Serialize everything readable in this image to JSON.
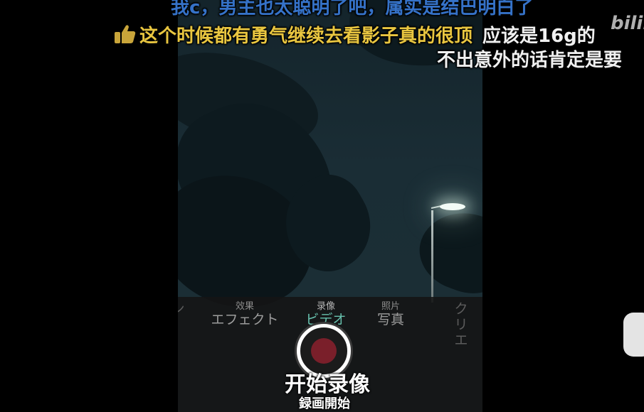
{
  "video": {
    "camera_modes": [
      {
        "cn": "",
        "jp": "ン",
        "state": "faded"
      },
      {
        "cn": "效果",
        "jp": "エフェクト",
        "state": "normal"
      },
      {
        "cn": "录像",
        "jp": "ビデオ",
        "state": "active"
      },
      {
        "cn": "照片",
        "jp": "写真",
        "state": "normal"
      },
      {
        "cn": "",
        "jp": "クリエ",
        "state": "faded"
      }
    ],
    "subtitle_cn": "开始录像",
    "subtitle_jp": "録画開始"
  },
  "danmaku": [
    {
      "text": "我c，男主也太聪明了吧，属实是结巴明白了",
      "color": "#3572c8"
    },
    {
      "text": "这个时候都有勇气继续去看影子真的很顶",
      "color": "#e9c640"
    },
    {
      "text": "应该是16g的",
      "color": "#f0f0f0"
    },
    {
      "text": "不出意外的话肯定是要",
      "color": "#f0f0f0"
    }
  ],
  "watermark": {
    "text": "bilib"
  },
  "colors": {
    "active_mode": "#67c0ad",
    "record_dot": "#7a1f2a"
  }
}
